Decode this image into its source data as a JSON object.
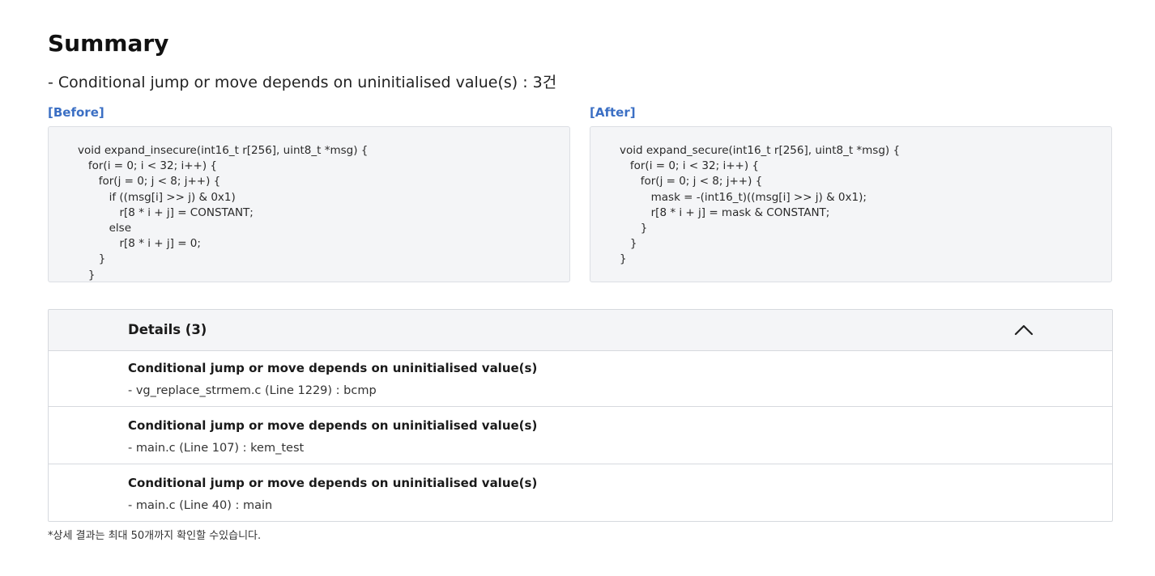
{
  "page_title": "Summary",
  "summary_line": "- Conditional jump or move depends on uninitialised value(s) : 3건",
  "before": {
    "label": "[Before]",
    "code": "void expand_insecure(int16_t r[256], uint8_t *msg) {\n   for(i = 0; i < 32; i++) {\n      for(j = 0; j < 8; j++) {\n         if ((msg[i] >> j) & 0x1)\n            r[8 * i + j] = CONSTANT;\n         else\n            r[8 * i + j] = 0;\n      }\n   }"
  },
  "after": {
    "label": "[After]",
    "code": "void expand_secure(int16_t r[256], uint8_t *msg) {\n   for(i = 0; i < 32; i++) {\n      for(j = 0; j < 8; j++) {\n         mask = -(int16_t)((msg[i] >> j) & 0x1);\n         r[8 * i + j] = mask & CONSTANT;\n      }\n   }\n}"
  },
  "details": {
    "title": "Details (3)",
    "collapse_icon": "chevron-up-icon",
    "items": [
      {
        "title": "Conditional jump or move depends on uninitialised value(s)",
        "location": "- vg_replace_strmem.c (Line 1229) : bcmp"
      },
      {
        "title": "Conditional jump or move depends on uninitialised value(s)",
        "location": "- main.c (Line 107) : kem_test"
      },
      {
        "title": "Conditional jump or move depends on uninitialised value(s)",
        "location": "- main.c (Line 40) : main"
      }
    ]
  },
  "footnote": "*상세 결과는 최대 50개까지 확인할 수있습니다.",
  "colors": {
    "label_blue": "#3b6fc4",
    "code_background": "#f4f5f7",
    "border": "#d6d9de"
  }
}
